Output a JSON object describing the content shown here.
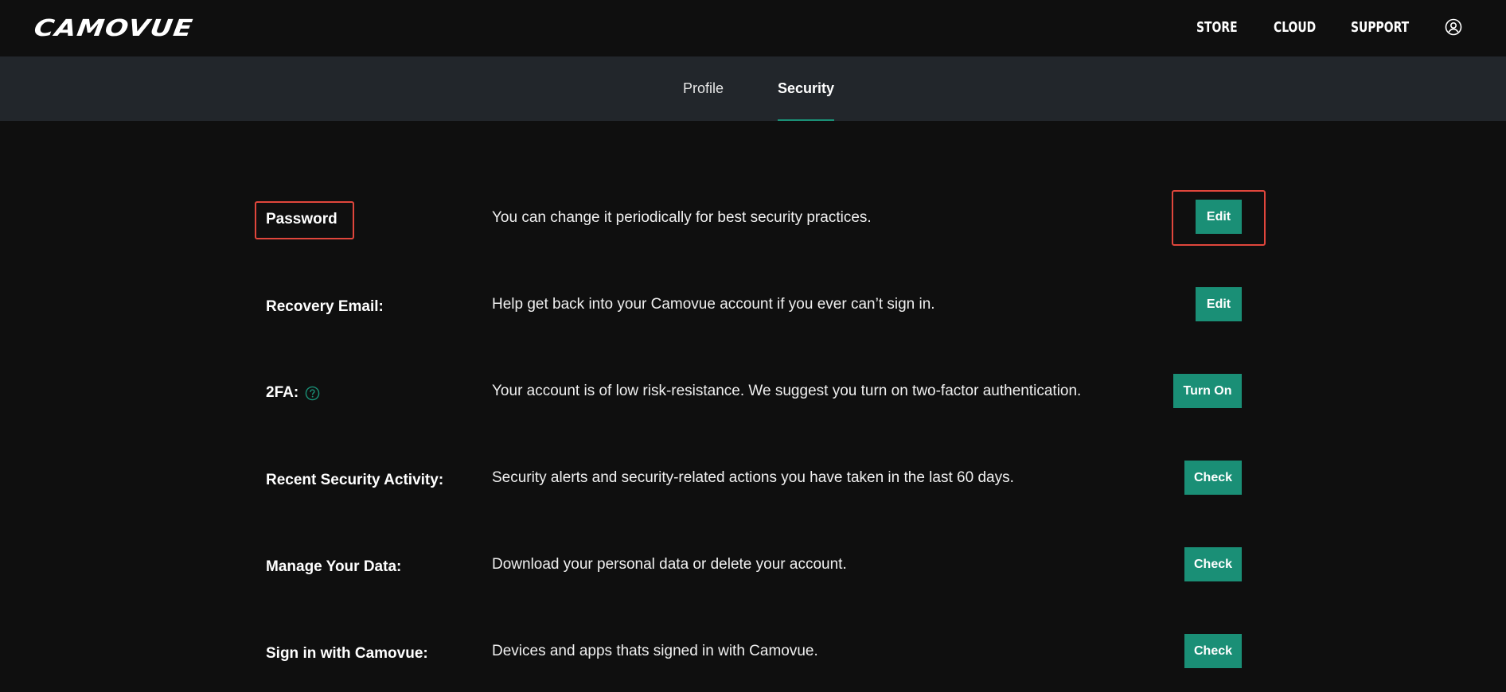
{
  "header": {
    "logo_text": "CAMOVUE",
    "nav": [
      {
        "label": "STORE"
      },
      {
        "label": "CLOUD"
      },
      {
        "label": "SUPPORT"
      }
    ],
    "user_icon": "user-circle-icon"
  },
  "tabs": [
    {
      "label": "Profile",
      "active": false
    },
    {
      "label": "Security",
      "active": true
    }
  ],
  "security": {
    "rows": [
      {
        "label": "Password",
        "description": "You can change it periodically for best security practices.",
        "button": "Edit"
      },
      {
        "label": "Recovery Email:",
        "description": "Help get back into your Camovue account if you ever can’t sign in.",
        "button": "Edit"
      },
      {
        "label": "2FA:",
        "description": "Your account is of low risk-resistance. We suggest you turn on two-factor authentication.",
        "button": "Turn On",
        "icon": "question-circle-icon"
      },
      {
        "label": "Recent Security Activity:",
        "description": "Security alerts and security-related actions you have taken in the last 60 days.",
        "button": "Check"
      },
      {
        "label": "Manage Your Data:",
        "description": "Download your personal data or delete your account.",
        "button": "Check"
      },
      {
        "label": "Sign in with Camovue:",
        "description": "Devices and apps thats signed in with Camovue.",
        "button": "Check"
      }
    ]
  },
  "colors": {
    "background": "#0f0f0f",
    "tabbar": "#22262b",
    "accent": "#1a8f76",
    "highlight": "#e0463c"
  }
}
